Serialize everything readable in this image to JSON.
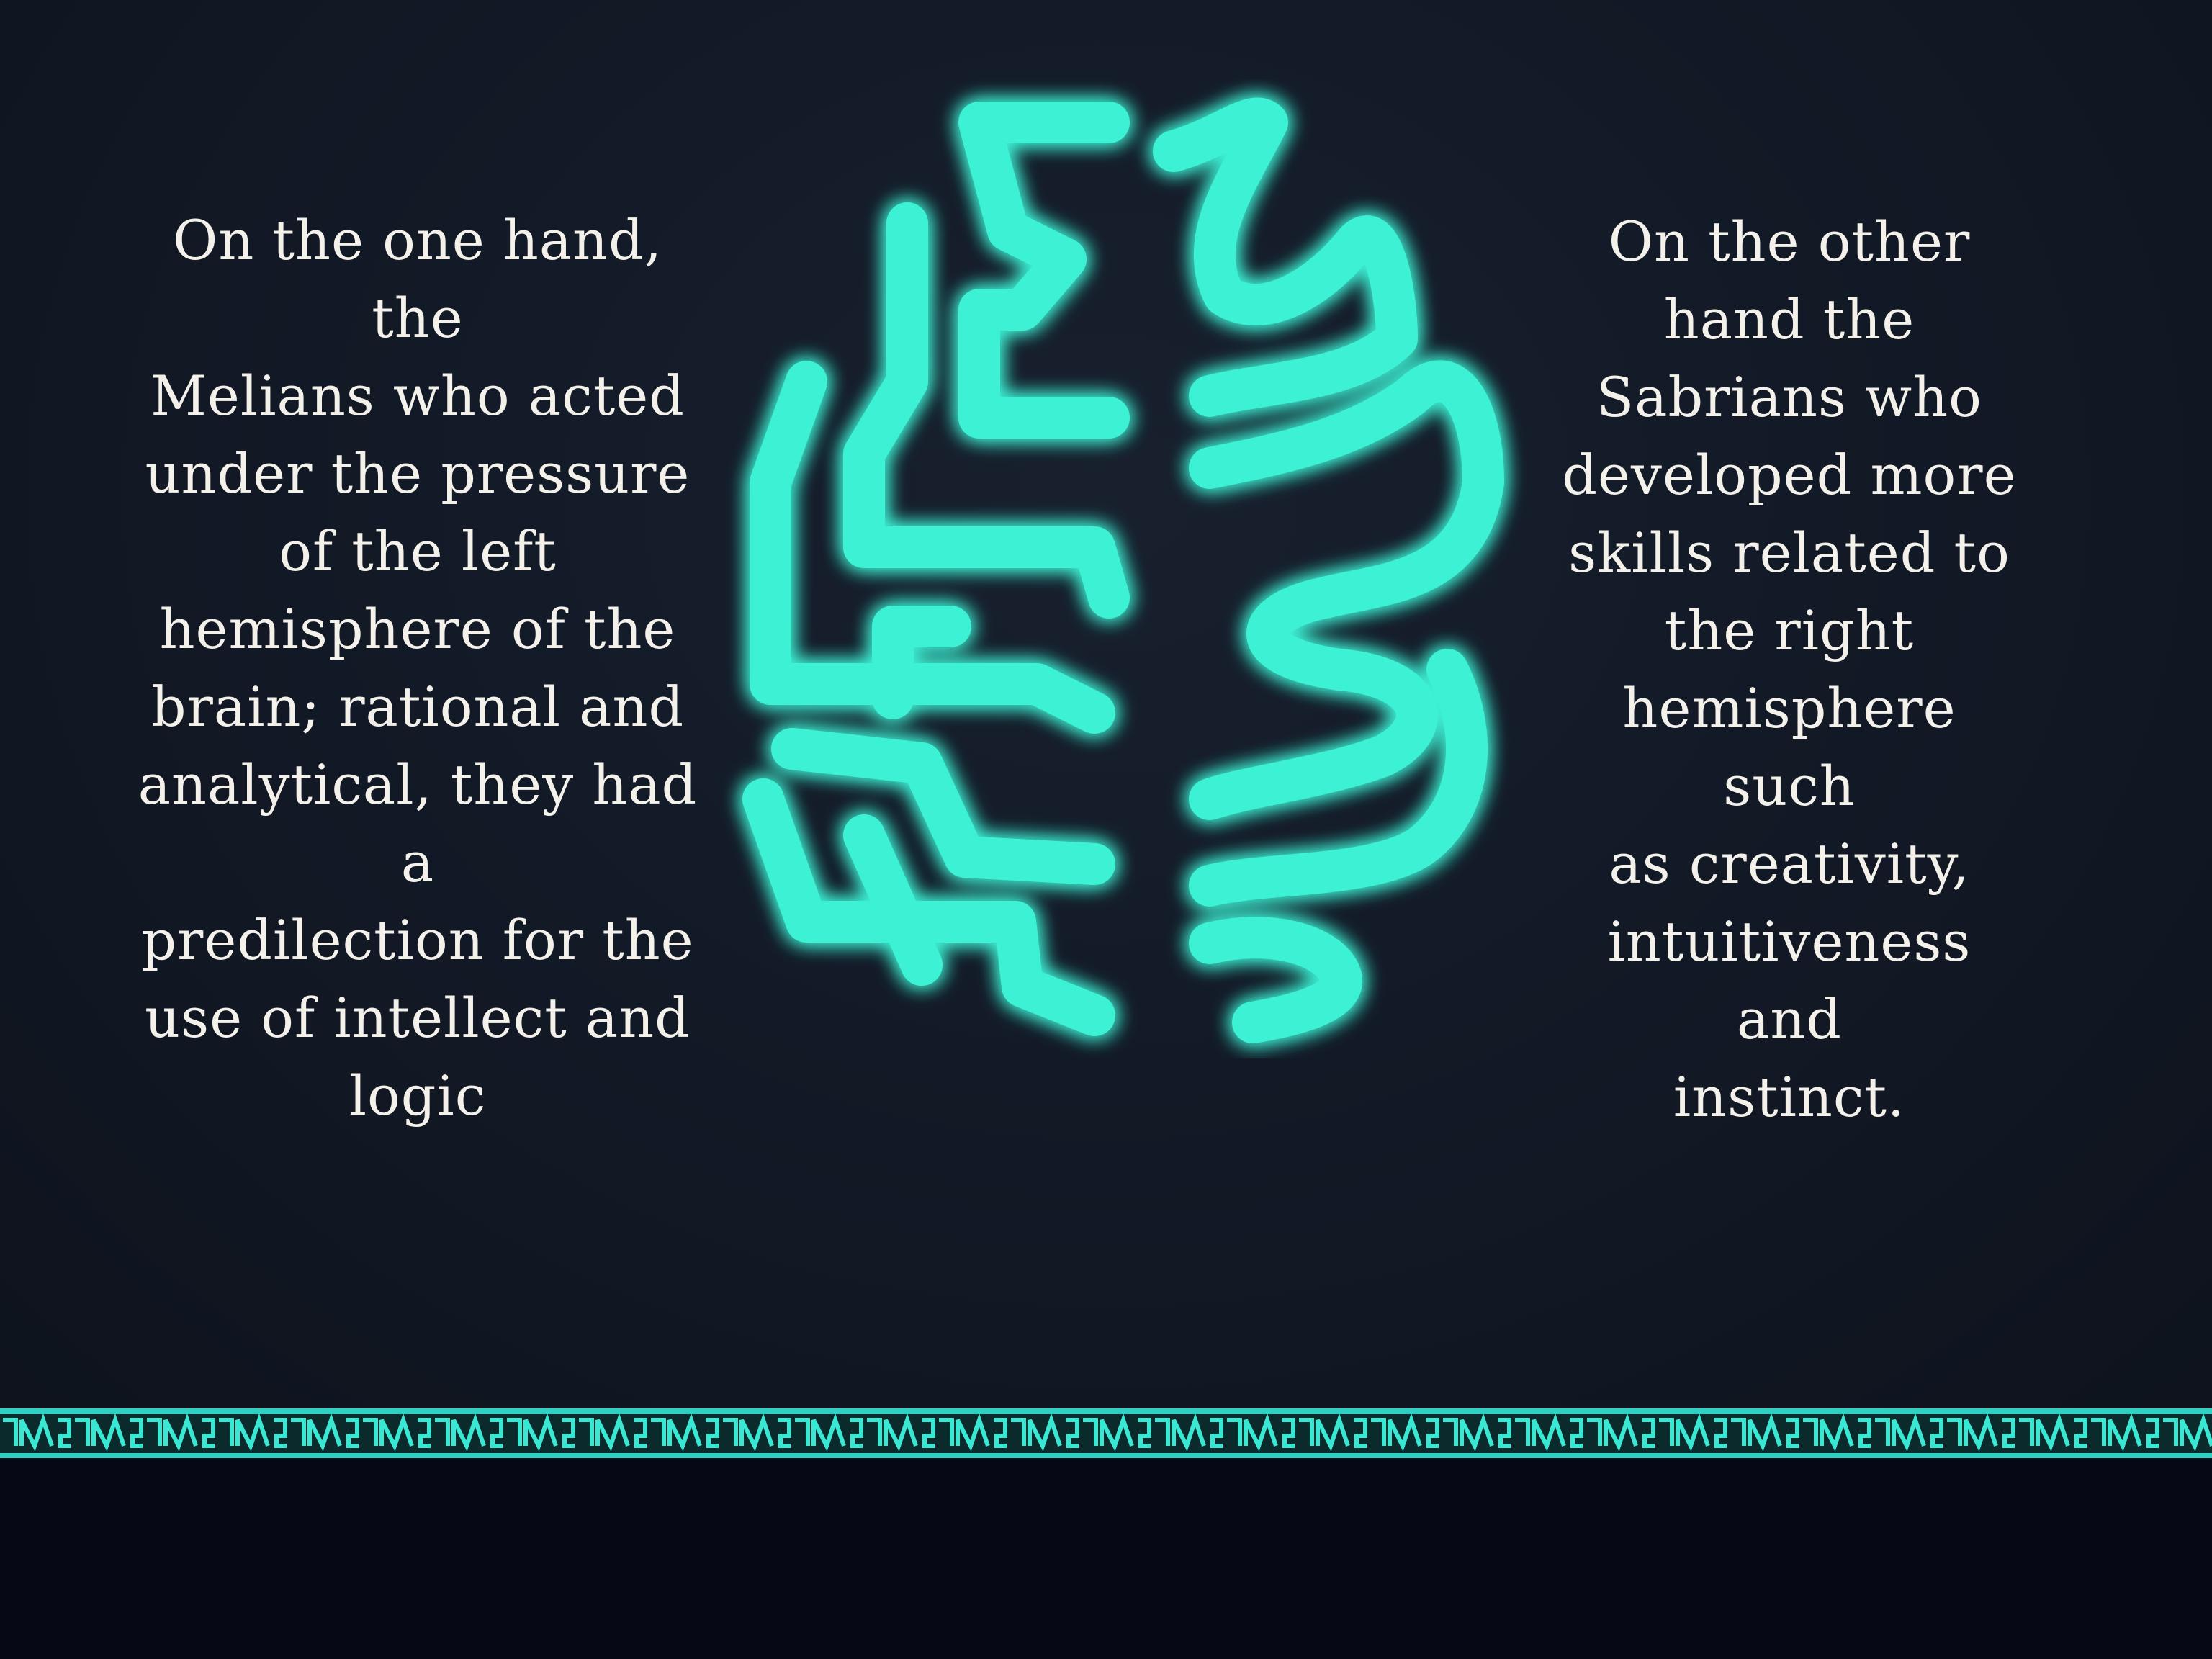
{
  "left_paragraph": "On the one hand, the\nMelians who acted\nunder the pressure\nof the left\nhemisphere of the\nbrain; rational and\nanalytical, they had a\npredilection for the\nuse of intellect and\nlogic",
  "right_paragraph": "On the other\nhand the\nSabrians who\ndeveloped more\nskills related to\nthe right\nhemisphere such\nas creativity,\nintuitiveness and\ninstinct.",
  "icons": {
    "brain": "glowing-brain-icon",
    "border": "greek-key-border"
  },
  "colors": {
    "background": "#131a27",
    "glow": "#39f5d6",
    "text": "#f3f1ea",
    "footer": "#070816"
  }
}
